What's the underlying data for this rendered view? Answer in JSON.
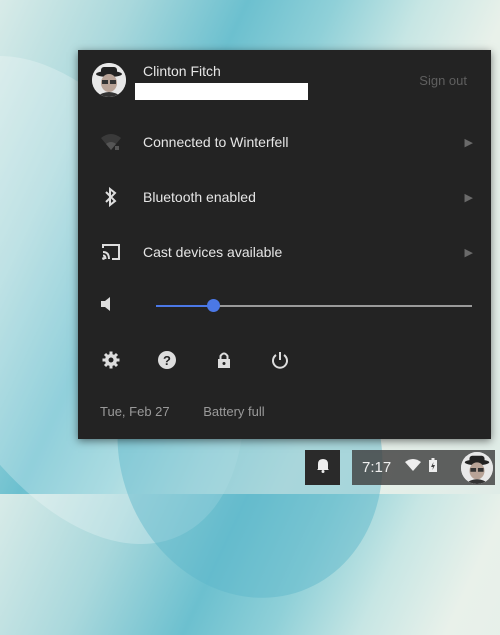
{
  "user": {
    "name": "Clinton Fitch",
    "sign_out_label": "Sign out"
  },
  "network": {
    "label": "Connected to Winterfell"
  },
  "bluetooth": {
    "label": "Bluetooth enabled"
  },
  "cast": {
    "label": "Cast devices available"
  },
  "volume": {
    "level_percent": 18
  },
  "status": {
    "date": "Tue, Feb 27",
    "battery": "Battery full"
  },
  "shelf": {
    "time": "7:17"
  },
  "colors": {
    "panel_bg": "#232323",
    "accent": "#4b78e6"
  },
  "icons": [
    "wifi-icon",
    "bluetooth-icon",
    "cast-icon",
    "volume-icon",
    "settings-icon",
    "help-icon",
    "lock-icon",
    "power-icon",
    "bell-icon",
    "battery-icon"
  ]
}
